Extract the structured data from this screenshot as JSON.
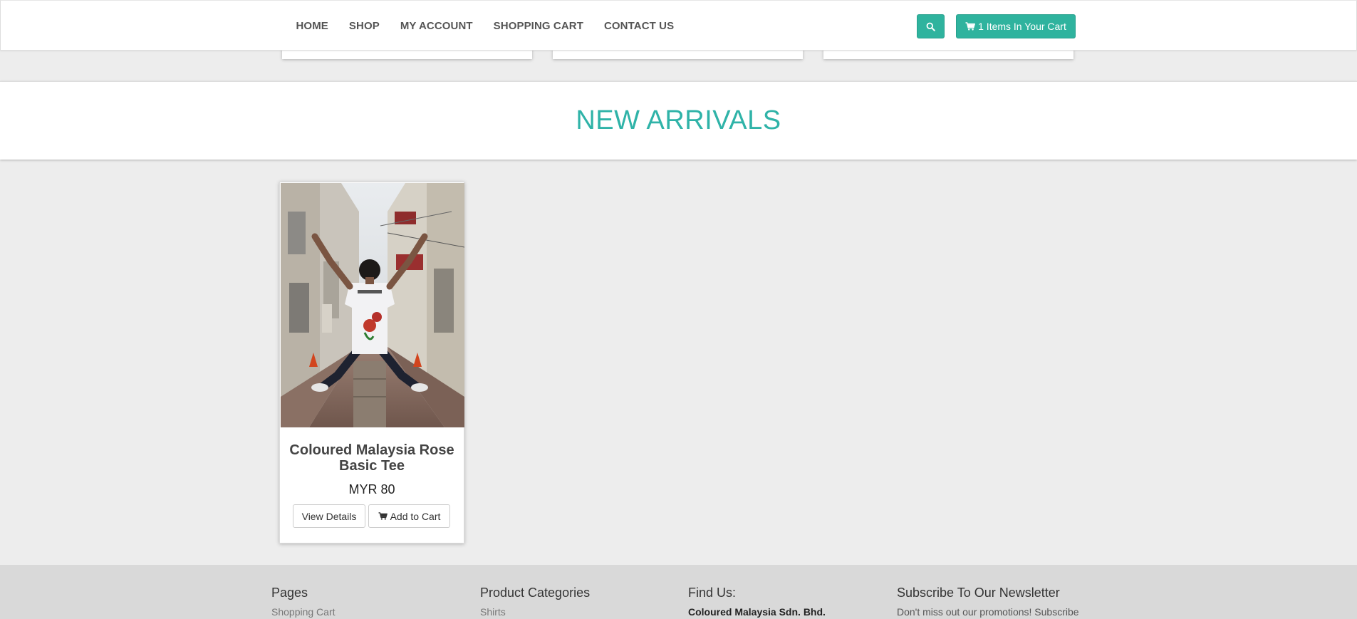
{
  "nav": {
    "links": [
      "HOME",
      "SHOP",
      "MY ACCOUNT",
      "SHOPPING CART",
      "CONTACT US"
    ],
    "cart_label": "1 Items In Your Cart"
  },
  "section": {
    "title": "NEW ARRIVALS"
  },
  "product": {
    "name": "Coloured Malaysia Rose Basic Tee",
    "price": "MYR 80",
    "view_label": "View Details",
    "add_label": "Add to Cart"
  },
  "footer": {
    "pages": {
      "heading": "Pages",
      "first_item": "Shopping Cart"
    },
    "categories": {
      "heading": "Product Categories",
      "first_item": "Shirts"
    },
    "find_us": {
      "heading": "Find Us:",
      "company": "Coloured Malaysia Sdn. Bhd."
    },
    "newsletter": {
      "heading": "Subscribe To Our Newsletter",
      "text": "Don't miss out our promotions! Subscribe"
    }
  },
  "colors": {
    "accent": "#2fb39e",
    "title": "#2fb3a8",
    "background": "#ededed",
    "footer": "#d9d9d9"
  },
  "icons": {
    "search": "search-icon",
    "cart": "cart-icon"
  }
}
